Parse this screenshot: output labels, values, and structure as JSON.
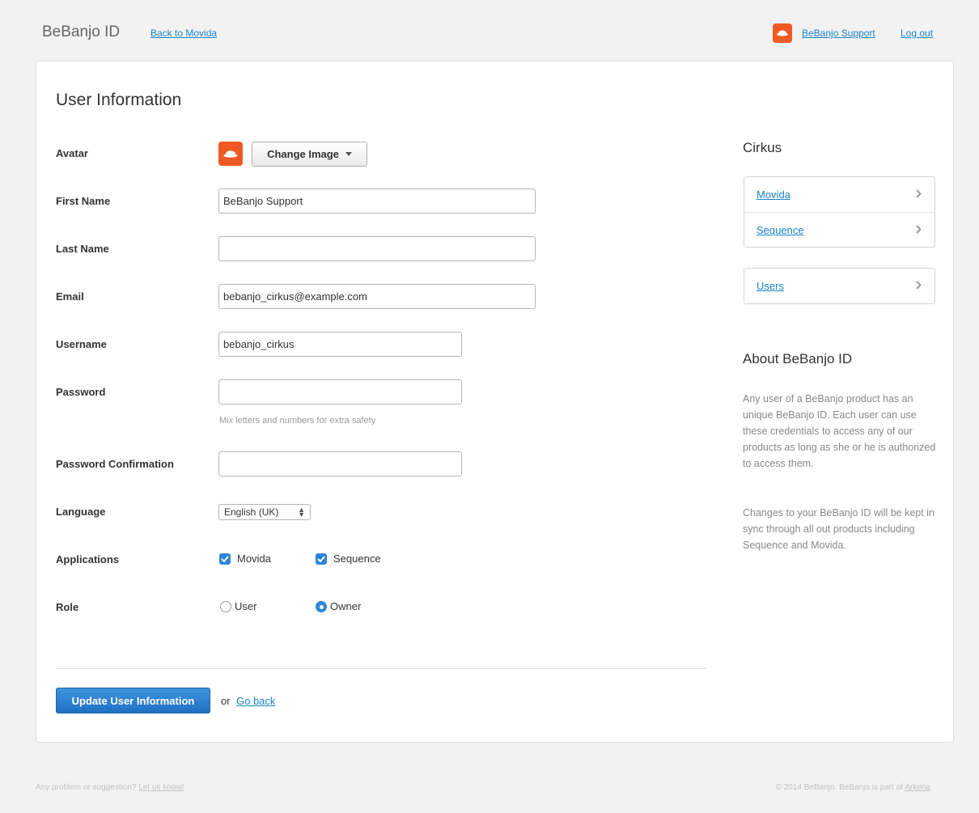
{
  "header": {
    "brand": "BeBanjo ID",
    "back_link": "Back to Movida",
    "user_link": "BeBanjo Support",
    "logout": "Log out"
  },
  "form": {
    "title": "User Information",
    "avatar": {
      "label": "Avatar",
      "change_button": "Change Image"
    },
    "first_name": {
      "label": "First Name",
      "value": "BeBanjo Support"
    },
    "last_name": {
      "label": "Last Name",
      "value": ""
    },
    "email": {
      "label": "Email",
      "value": "bebanjo_cirkus@example.com"
    },
    "username": {
      "label": "Username",
      "value": "bebanjo_cirkus"
    },
    "password": {
      "label": "Password",
      "value": "",
      "hint": "Mix letters and numbers for extra safety"
    },
    "password_confirmation": {
      "label": "Password Confirmation",
      "value": ""
    },
    "language": {
      "label": "Language",
      "selected": "English (UK)"
    },
    "applications": {
      "label": "Applications",
      "options": [
        {
          "label": "Movida",
          "checked": true
        },
        {
          "label": "Sequence",
          "checked": true
        }
      ]
    },
    "role": {
      "label": "Role",
      "options": [
        {
          "label": "User",
          "selected": false
        },
        {
          "label": "Owner",
          "selected": true
        }
      ]
    },
    "submit_label": "Update User Information",
    "or_text": "or",
    "go_back": "Go back"
  },
  "sidebar": {
    "org_title": "Cirkus",
    "apps": [
      {
        "label": "Movida"
      },
      {
        "label": "Sequence"
      }
    ],
    "admin": [
      {
        "label": "Users"
      }
    ],
    "about_title": "About BeBanjo ID",
    "about_paragraphs": [
      "Any user of a BeBanjo product has an unique BeBanjo ID. Each user can use these credentials to access any of our products as long as she or he is authorized to access them.",
      "Changes to your BeBanjo ID will be kept in sync through all out products including Sequence and Movida."
    ]
  },
  "footer": {
    "left_text": "Any problem or suggestion?",
    "left_link": "Let us know!",
    "right_text": "© 2014 BeBanjo. BeBanjo is part of",
    "right_link": "Arkena"
  },
  "colors": {
    "accent": "#1a84c8",
    "avatar": "#ef5a24",
    "primary_button": "#1f70c2",
    "checkbox": "#2f86d6"
  }
}
